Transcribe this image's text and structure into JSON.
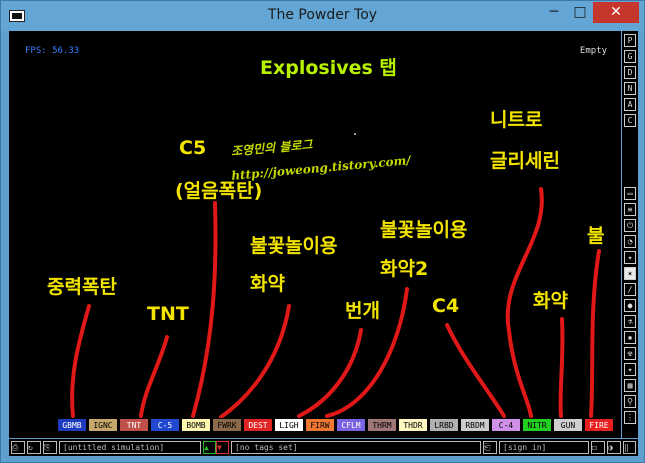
{
  "window": {
    "title": "The Powder Toy",
    "minimize": "─",
    "maximize": "□",
    "close": "✕"
  },
  "status": {
    "fps": "FPS: 56.33",
    "hover": "Empty"
  },
  "annotations": {
    "title": "Explosives 탭",
    "blog_name": "조영민의 블로그",
    "blog_url": "http://joweong.tistory.com/",
    "c5": "C5",
    "c5_sub": "(얼음폭탄)",
    "gbmb": "중력폭탄",
    "tnt": "TNT",
    "fwrk_1": "불꽃놀이용",
    "fwrk_2": "화약",
    "ligh": "번개",
    "firw_1": "불꽃놀이용",
    "firw_2": "화약2",
    "c4": "C4",
    "nitr_1": "니트로",
    "nitr_2": "글리세린",
    "gun": "화약",
    "fire": "불"
  },
  "elements": [
    {
      "label": "GBMB",
      "bg": "#1d3bbf",
      "fg": "#ffffff"
    },
    {
      "label": "IGNC",
      "bg": "#c8a86a",
      "fg": "#000000"
    },
    {
      "label": "TNT",
      "bg": "#c0504a",
      "fg": "#ffffff"
    },
    {
      "label": "C-5",
      "bg": "#2248d0",
      "fg": "#ffffff"
    },
    {
      "label": "BOMB",
      "bg": "#fff7b0",
      "fg": "#000000"
    },
    {
      "label": "FWRK",
      "bg": "#8a6a4a",
      "fg": "#000000"
    },
    {
      "label": "DEST",
      "bg": "#e02424",
      "fg": "#ffffff"
    },
    {
      "label": "LIGH",
      "bg": "#ffffff",
      "fg": "#000000"
    },
    {
      "label": "FIRW",
      "bg": "#f07830",
      "fg": "#000000"
    },
    {
      "label": "CFLM",
      "bg": "#7a62e0",
      "fg": "#ffffff"
    },
    {
      "label": "THRM",
      "bg": "#a07878",
      "fg": "#000000"
    },
    {
      "label": "THDR",
      "bg": "#fff8c0",
      "fg": "#000000"
    },
    {
      "label": "LRBD",
      "bg": "#b0b0b0",
      "fg": "#000000"
    },
    {
      "label": "RBDM",
      "bg": "#cccccc",
      "fg": "#000000"
    },
    {
      "label": "C-4",
      "bg": "#d090e8",
      "fg": "#000000"
    },
    {
      "label": "NITR",
      "bg": "#22d022",
      "fg": "#000000"
    },
    {
      "label": "GUN",
      "bg": "#cfcfcf",
      "fg": "#000000"
    },
    {
      "label": "FIRE",
      "bg": "#e82020",
      "fg": "#ffffff"
    }
  ],
  "sidebar": {
    "top_buttons": [
      "P",
      "G",
      "D",
      "N",
      "A",
      "C"
    ]
  },
  "bottom": {
    "save_name": "[untitled simulation]",
    "tags": "[no tags set]",
    "sign_in": "[sign in]"
  },
  "colors": {
    "annotation_text": "#f3e400",
    "annotation_lines": "#e01818",
    "title_text": "#b6f200",
    "fps_text": "#3a7fff"
  }
}
